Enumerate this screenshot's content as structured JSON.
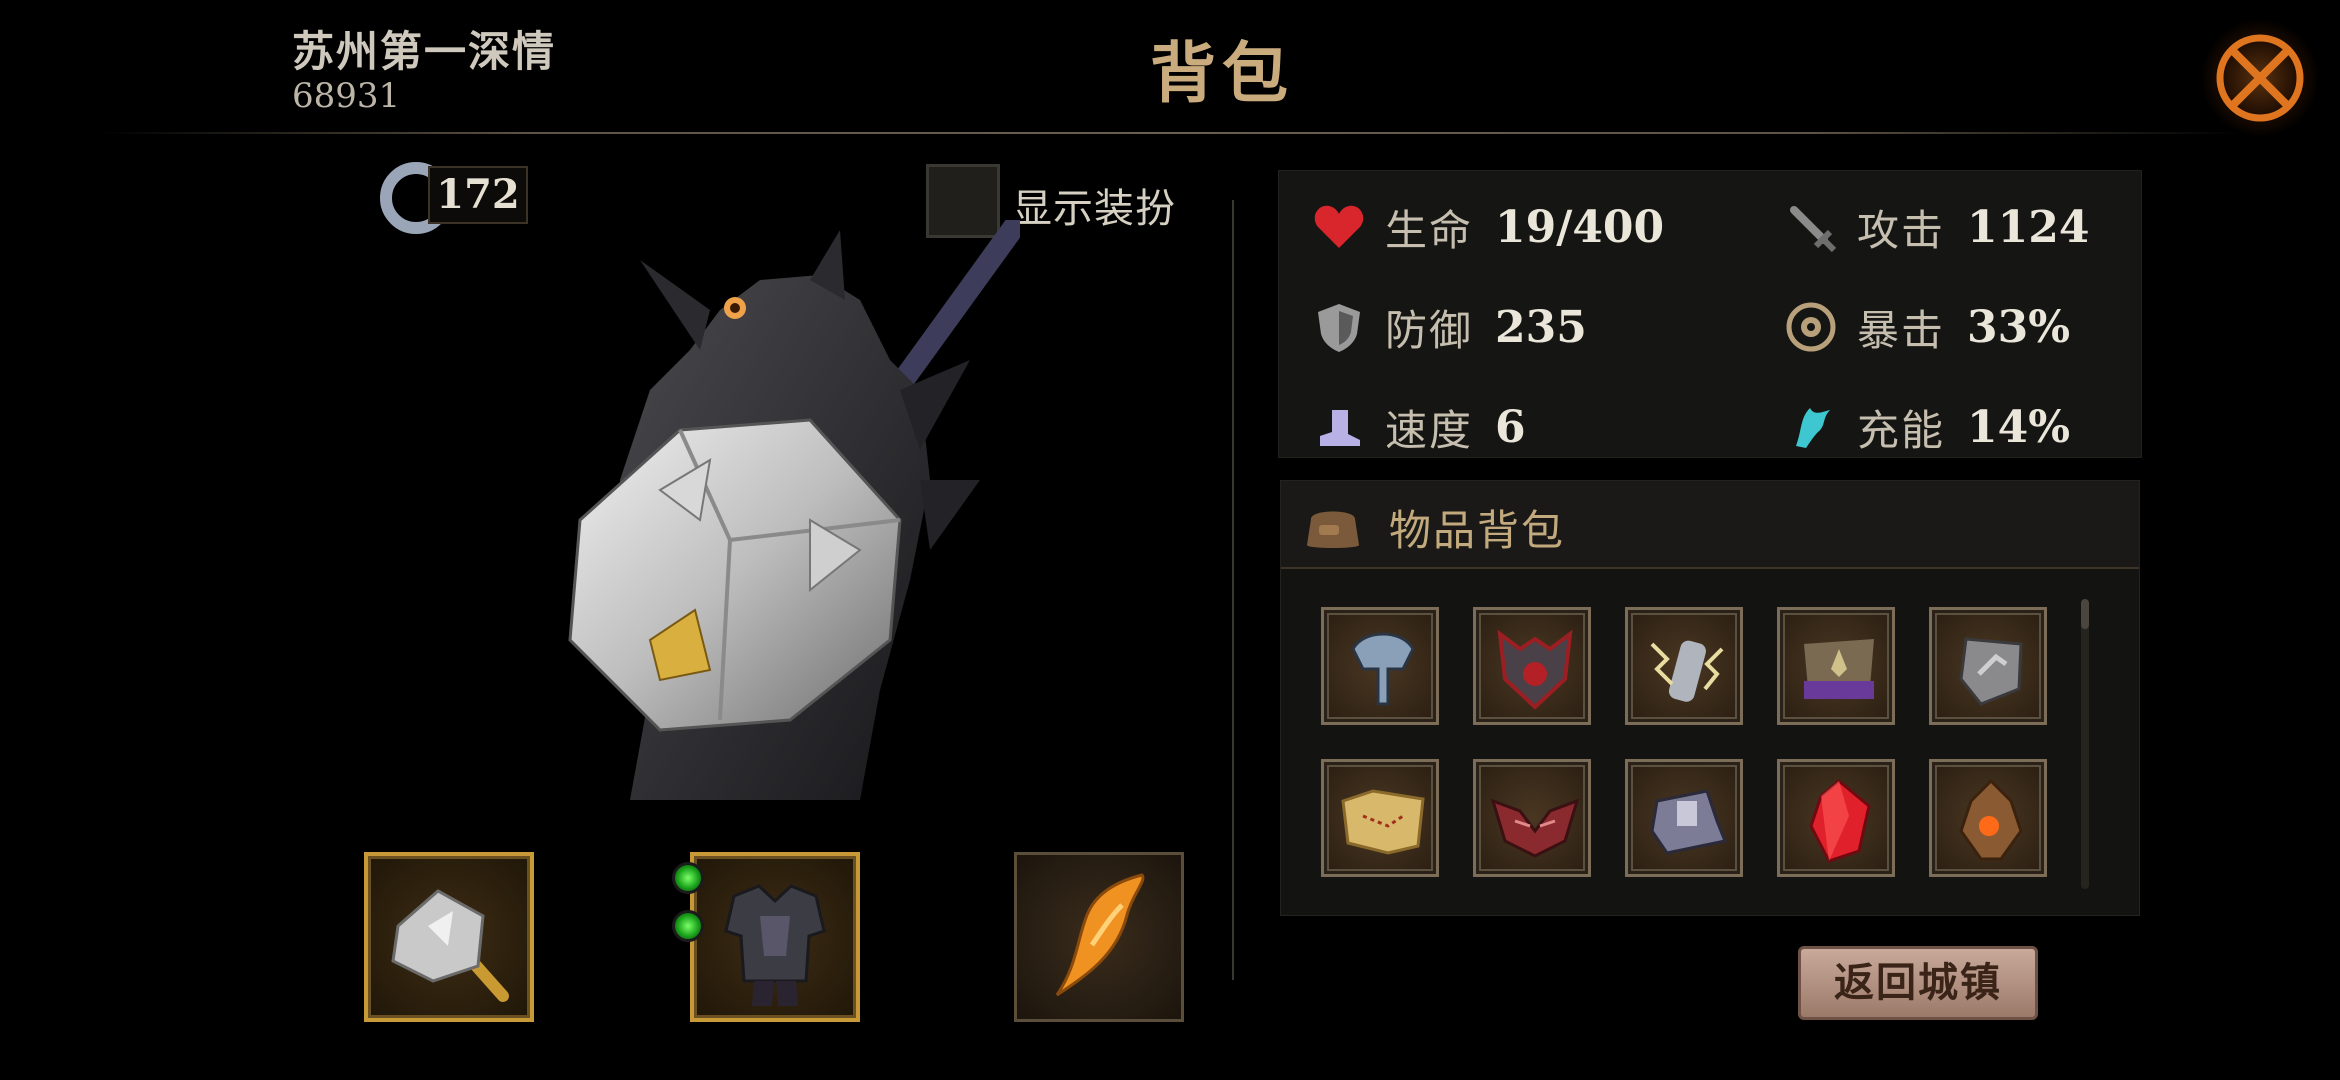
{
  "header": {
    "player_name": "苏州第一深情",
    "player_id": "68931",
    "title": "背包",
    "close_icon": "close-crossed-swords-icon"
  },
  "left": {
    "gem_count": "172",
    "costume_label": "显示装扮",
    "costume_checked": false,
    "equipment": [
      {
        "slot": "weapon",
        "icon": "spiked-mace-icon"
      },
      {
        "slot": "armor",
        "icon": "dark-armor-icon",
        "socket_gems": 2
      },
      {
        "slot": "accessory",
        "icon": "flame-horn-icon"
      }
    ]
  },
  "stats": {
    "hp": {
      "label": "生命",
      "value": "19/400"
    },
    "attack": {
      "label": "攻击",
      "value": "1124"
    },
    "defense": {
      "label": "防御",
      "value": "235"
    },
    "crit": {
      "label": "暴击",
      "value": "33%"
    },
    "speed": {
      "label": "速度",
      "value": "6"
    },
    "charge": {
      "label": "充能",
      "value": "14%"
    }
  },
  "inventory": {
    "title": "物品背包",
    "items": [
      {
        "icon": "steel-helmet-icon"
      },
      {
        "icon": "demon-helmet-icon"
      },
      {
        "icon": "lightning-gauntlet-icon"
      },
      {
        "icon": "purple-bracer-icon"
      },
      {
        "icon": "steel-shield-icon"
      },
      {
        "icon": "treasure-map-icon"
      },
      {
        "icon": "winged-mask-icon"
      },
      {
        "icon": "iron-boots-icon"
      },
      {
        "icon": "red-crystal-icon"
      },
      {
        "icon": "fire-core-icon"
      }
    ]
  },
  "return_button": "返回城镇",
  "colors": {
    "title_gold": "#c9ab7d",
    "equip_border_gold": "#c79a37",
    "hp_red": "#d9262c",
    "charge_cyan": "#3ec7d1"
  }
}
